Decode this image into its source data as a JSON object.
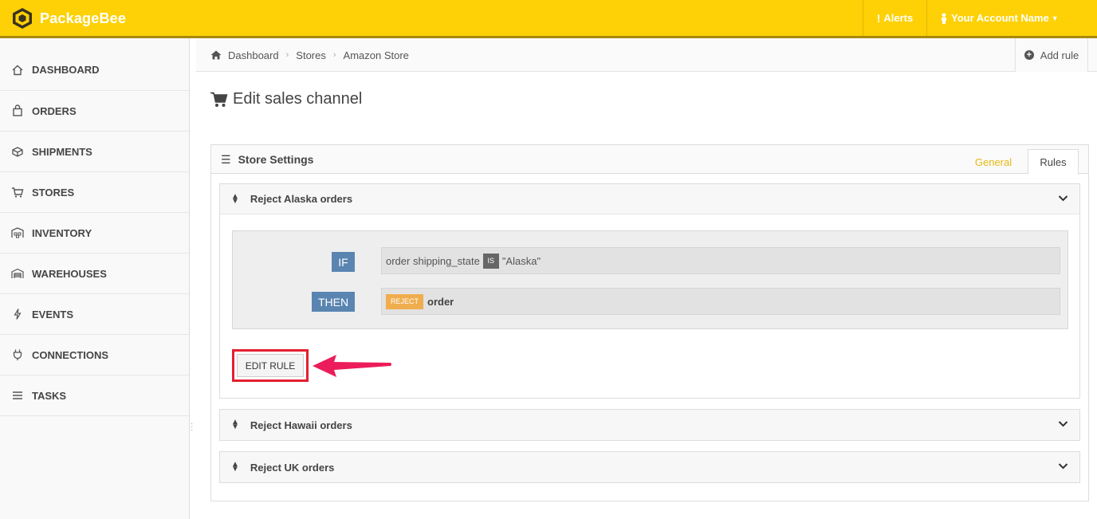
{
  "app": {
    "name": "PackageBee"
  },
  "topbar": {
    "alerts_label": "Alerts",
    "account_label": "Your Account Name"
  },
  "sidebar": {
    "items": [
      {
        "label": "DASHBOARD",
        "icon": "home-icon"
      },
      {
        "label": "ORDERS",
        "icon": "bag-icon"
      },
      {
        "label": "SHIPMENTS",
        "icon": "package-icon"
      },
      {
        "label": "STORES",
        "icon": "cart-icon"
      },
      {
        "label": "INVENTORY",
        "icon": "inventory-icon"
      },
      {
        "label": "WAREHOUSES",
        "icon": "warehouse-icon"
      },
      {
        "label": "EVENTS",
        "icon": "bolt-icon"
      },
      {
        "label": "CONNECTIONS",
        "icon": "plug-icon"
      },
      {
        "label": "TASKS",
        "icon": "list-icon"
      }
    ]
  },
  "breadcrumb": {
    "items": [
      "Dashboard",
      "Stores",
      "Amazon Store"
    ]
  },
  "header_actions": {
    "add_rule_label": "Add rule"
  },
  "page": {
    "title": "Edit sales channel"
  },
  "panel": {
    "title": "Store Settings",
    "tabs": [
      {
        "label": "General",
        "active": false
      },
      {
        "label": "Rules",
        "active": true
      }
    ]
  },
  "rules": [
    {
      "title": "Reject Alaska orders",
      "expanded": true,
      "if_keyword": "IF",
      "then_keyword": "THEN",
      "condition": {
        "field": "order shipping_state",
        "operator": "IS",
        "value": "\"Alaska\""
      },
      "action": {
        "badge": "REJECT",
        "target": "order"
      },
      "edit_label": "EDIT RULE"
    },
    {
      "title": "Reject Hawaii orders",
      "expanded": false
    },
    {
      "title": "Reject UK orders",
      "expanded": false
    }
  ],
  "colors": {
    "brand_yellow": "#fdd105",
    "keyword_blue": "#5a85b1",
    "reject_orange": "#f0ad4e",
    "highlight_red": "#e32030",
    "arrow_pink": "#ec1c5a",
    "tab_general": "#e8b812"
  }
}
